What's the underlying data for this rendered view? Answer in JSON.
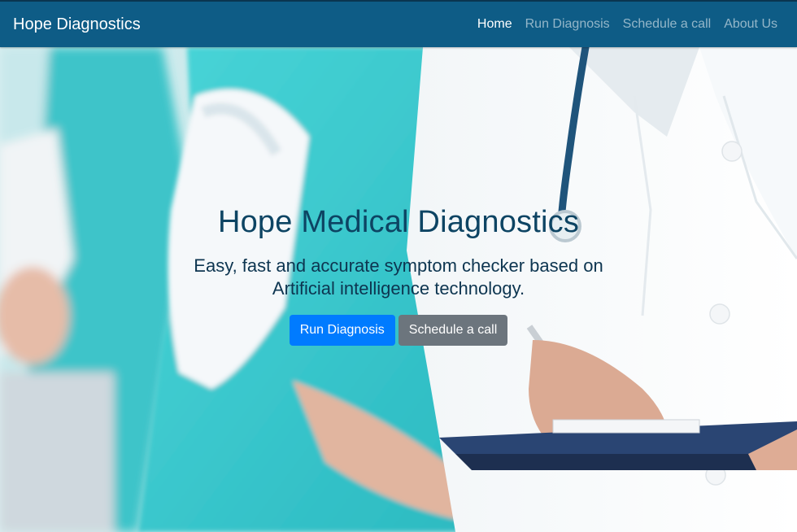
{
  "navbar": {
    "brand": "Hope Diagnostics",
    "links": [
      {
        "label": "Home",
        "active": true
      },
      {
        "label": "Run Diagnosis",
        "active": false
      },
      {
        "label": "Schedule a call",
        "active": false
      },
      {
        "label": "About Us",
        "active": false
      }
    ]
  },
  "hero": {
    "title": "Hope Medical Diagnostics",
    "subtitle": "Easy, fast and accurate symptom checker based on Artificial intelligence technology.",
    "primary_button": "Run Diagnosis",
    "secondary_button": "Schedule a call"
  },
  "colors": {
    "navbar_bg": "#0e5c86",
    "primary_button": "#007bff",
    "secondary_button": "#6c757d",
    "title_text": "#0d4463"
  }
}
